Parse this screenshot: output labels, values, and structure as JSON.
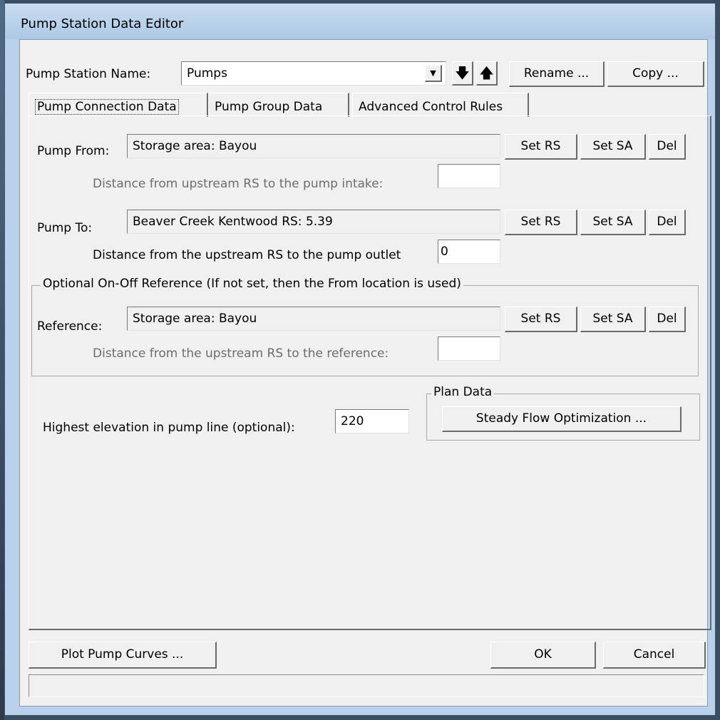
{
  "window": {
    "title": "Pump Station Data Editor"
  },
  "station": {
    "name_label": "Pump Station Name:",
    "name_value": "Pumps",
    "down_arrow": "🡇",
    "up_arrow": "🡅",
    "rename_label": "Rename ...",
    "copy_label": "Copy ..."
  },
  "tabs": [
    {
      "label": "Pump Connection Data"
    },
    {
      "label": "Pump Group Data"
    },
    {
      "label": "Advanced Control Rules"
    }
  ],
  "pump_from": {
    "label": "Pump From:",
    "value": "Storage area: Bayou",
    "set_rs": "Set RS",
    "set_sa": "Set SA",
    "del": "Del",
    "distance_label": "Distance from upstream RS to the pump intake:",
    "distance_value": ""
  },
  "pump_to": {
    "label": "Pump To:",
    "value": "Beaver Creek  Kentwood  RS: 5.39",
    "set_rs": "Set RS",
    "set_sa": "Set SA",
    "del": "Del",
    "distance_label": "Distance from the upstream RS to the pump outlet",
    "distance_value": "0"
  },
  "reference": {
    "group_title": "Optional On-Off Reference (If not set, then the From location is used)",
    "label": "Reference:",
    "value": "Storage area: Bayou",
    "set_rs": "Set RS",
    "set_sa": "Set SA",
    "del": "Del",
    "distance_label": "Distance from the upstream RS to the reference:",
    "distance_value": ""
  },
  "elevation": {
    "label": "Highest elevation in pump line (optional):",
    "value": "220"
  },
  "plan_data": {
    "group_title": "Plan Data",
    "button_label": "Steady Flow Optimization ..."
  },
  "footer": {
    "plot_label": "Plot Pump Curves ...",
    "ok_label": "OK",
    "cancel_label": "Cancel",
    "status_text": ""
  }
}
